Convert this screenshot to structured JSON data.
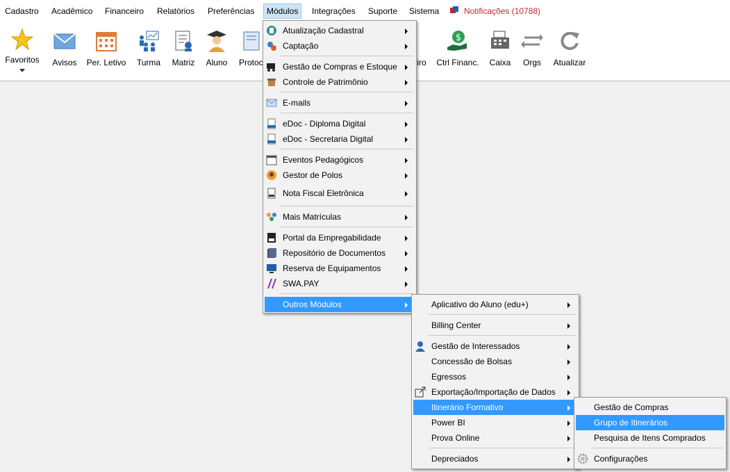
{
  "menubar": {
    "items": [
      "Cadastro",
      "Acadêmico",
      "Financeiro",
      "Relatórios",
      "Preferências",
      "Módulos",
      "Integrações",
      "Suporte",
      "Sistema"
    ],
    "notifications": "Notificações (10788)"
  },
  "toolbar": {
    "buttons": [
      "Favoritos",
      "Avisos",
      "Per. Letivo",
      "Turma",
      "Matriz",
      "Aluno",
      "Protoc",
      "iro",
      "Ctrl Financ.",
      "Caixa",
      "Orgs",
      "Atualizar"
    ]
  },
  "modulos_menu": {
    "items": [
      {
        "label": "Atualização Cadastral",
        "icon": "form-icon"
      },
      {
        "label": "Captação",
        "icon": "captacao-icon"
      },
      {
        "label": "Gestão de Compras e Estoque",
        "icon": "cart-icon"
      },
      {
        "label": "Controle de Patrimônio",
        "icon": "box-icon"
      },
      {
        "label": "E-mails",
        "icon": "envelope-icon"
      },
      {
        "label": "eDoc - Diploma Digital",
        "icon": "doc-icon"
      },
      {
        "label": "eDoc - Secretaria Digital",
        "icon": "doc-icon"
      },
      {
        "label": "Eventos Pedagógicos",
        "icon": "calendar-icon"
      },
      {
        "label": "Gestor de Polos",
        "icon": "person-icon"
      },
      {
        "label": "Nota Fiscal Eletrônica",
        "icon": "invoice-icon"
      },
      {
        "label": "Mais Matrículas",
        "icon": "people-icon"
      },
      {
        "label": "Portal da Empregabilidade",
        "icon": "cv-icon"
      },
      {
        "label": "Repositório de Documentos",
        "icon": "folder-icon"
      },
      {
        "label": "Reserva de Equipamentos",
        "icon": "monitor-icon"
      },
      {
        "label": "SWA.PAY",
        "icon": "swapay-icon"
      },
      {
        "label": "Outros Módulos",
        "icon": ""
      }
    ]
  },
  "outros_menu": {
    "items": [
      {
        "label": "Aplicativo do Aluno (edu+)"
      },
      {
        "label": "Billing Center"
      },
      {
        "label": "Gestão de Interessados"
      },
      {
        "label": "Concessão de Bolsas"
      },
      {
        "label": "Egressos"
      },
      {
        "label": "Exportação/Importação de Dados"
      },
      {
        "label": "Itinerário Formativo"
      },
      {
        "label": "Power BI"
      },
      {
        "label": "Prova Online"
      },
      {
        "label": "Depreciados"
      }
    ]
  },
  "itinerario_menu": {
    "items": [
      {
        "label": "Gestão de Compras"
      },
      {
        "label": "Grupo de Itinerários"
      },
      {
        "label": "Pesquisa de Itens Comprados"
      },
      {
        "label": "Configurações"
      }
    ]
  },
  "colors": {
    "highlight": "#3399ff",
    "notification": "#c0282d"
  }
}
